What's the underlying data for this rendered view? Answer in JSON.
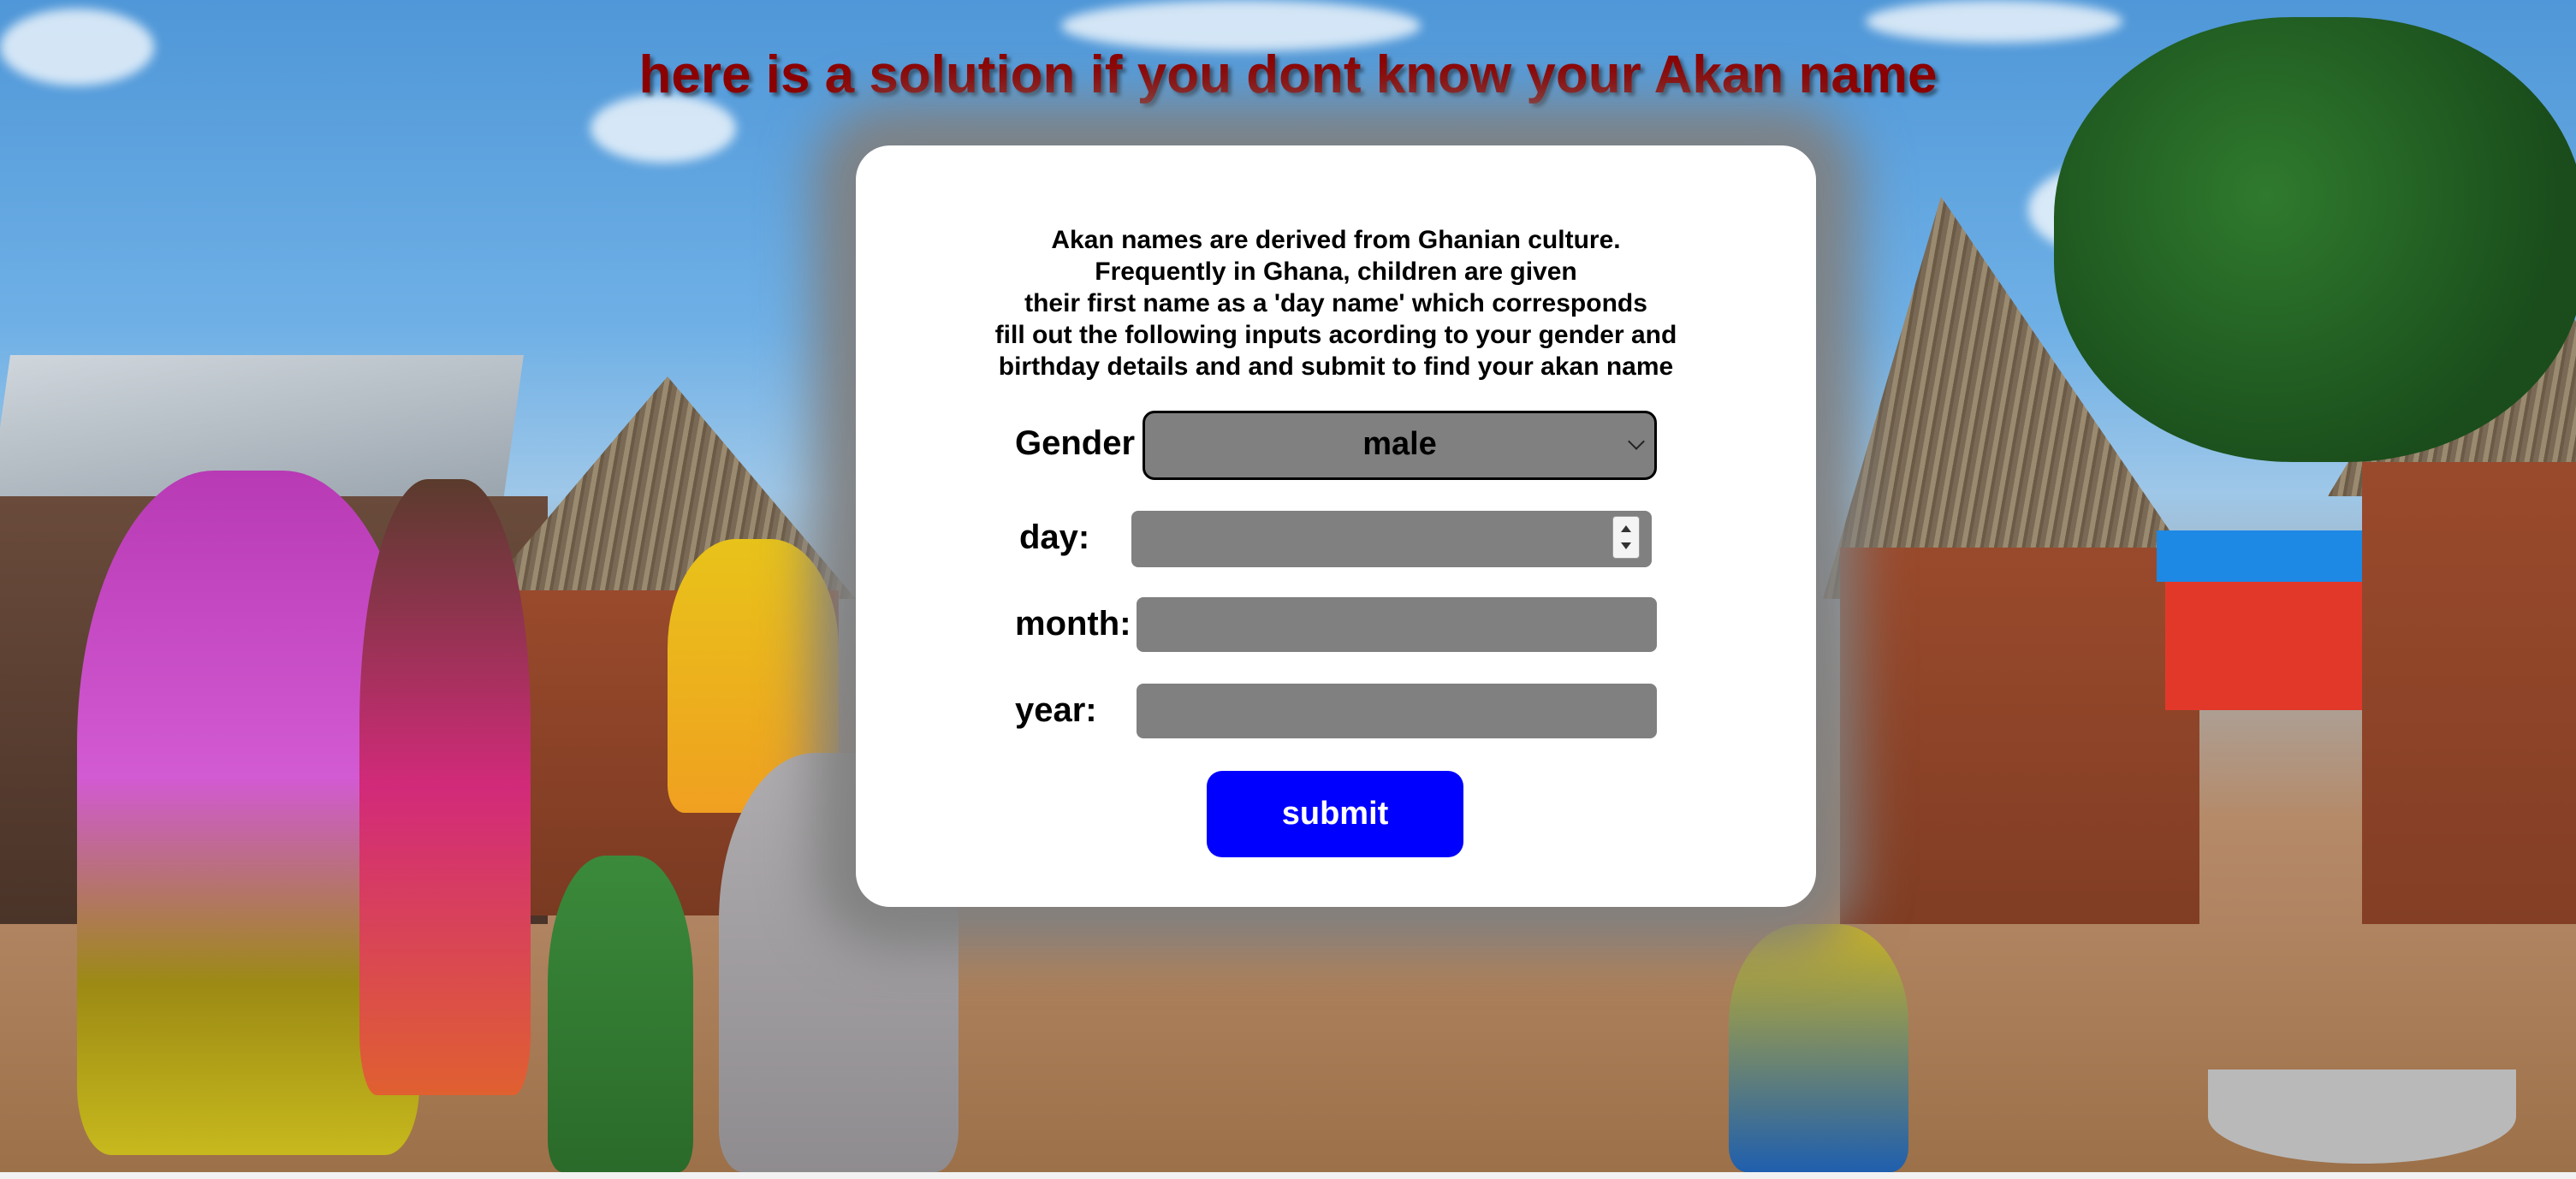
{
  "page": {
    "heading": "here is a solution if you dont know your Akan name"
  },
  "intro": {
    "lines": [
      "Akan names are derived from Ghanian culture.",
      "Frequently in Ghana, children are given",
      "their first name as a 'day name' which corresponds",
      "fill out the following inputs acording to your gender and",
      "birthday details and and submit to find your akan name"
    ]
  },
  "form": {
    "gender": {
      "label": "Gender",
      "selected": "male"
    },
    "day": {
      "label": "day:",
      "value": ""
    },
    "month": {
      "label": "month:",
      "value": ""
    },
    "year": {
      "label": "year:",
      "value": ""
    },
    "submit_label": "submit"
  },
  "colors": {
    "heading": "#8b0000",
    "field_bg": "#808080",
    "submit_bg": "#0000ff"
  },
  "icons": {
    "select": "chevron-down-icon",
    "spinner": "number-spinner-icon"
  }
}
